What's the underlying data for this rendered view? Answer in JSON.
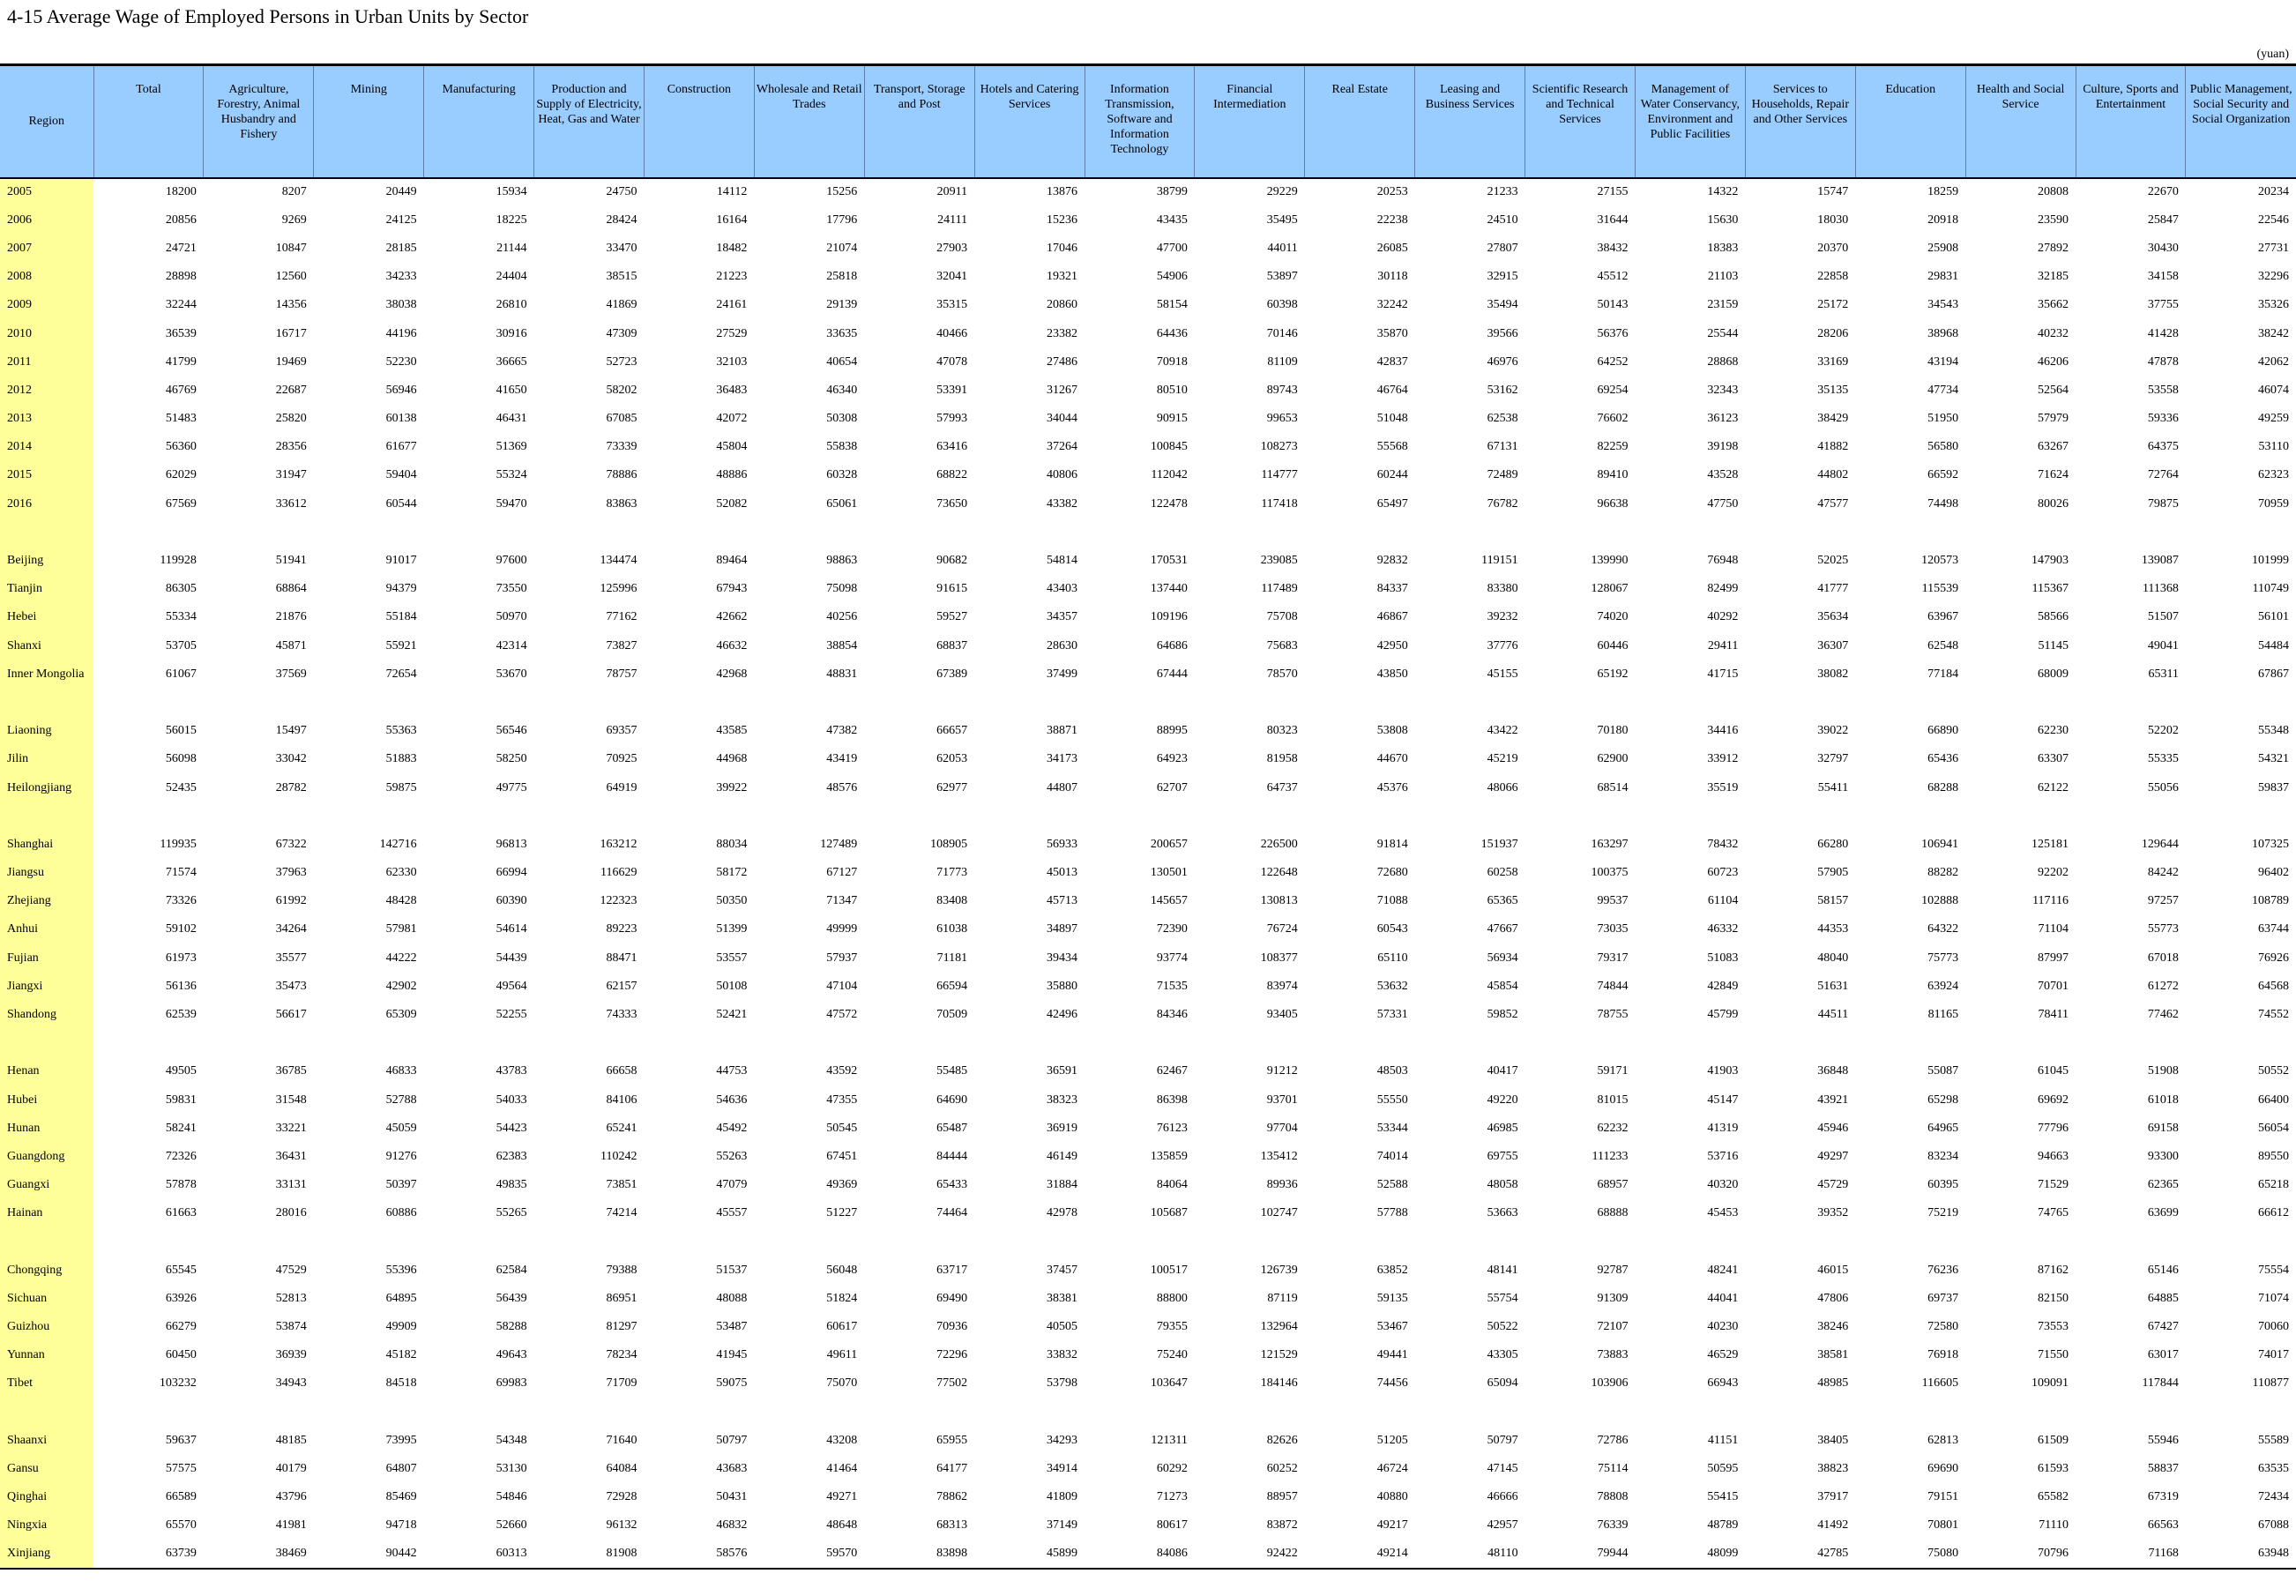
{
  "title": "4-15  Average Wage of Employed Persons in Urban Units by Sector",
  "unit": "(yuan)",
  "columns": [
    "Region",
    "Total",
    "Agriculture, Forestry, Animal Husbandry and Fishery",
    "Mining",
    "Manufacturing",
    "Production and Supply of Electricity, Heat, Gas and Water",
    "Construction",
    "Wholesale and Retail Trades",
    "Transport, Storage and Post",
    "Hotels and Catering Services",
    "Information Transmission, Software and Information Technology",
    "Financial Intermediation",
    "Real Estate",
    "Leasing and Business Services",
    "Scientific Research and Technical Services",
    "Management of Water Conservancy, Environment and Public Facilities",
    "Services to Households, Repair and Other Services",
    "Education",
    "Health and Social Service",
    "Culture, Sports and Entertainment",
    "Public Management, Social Security and Social Organization"
  ],
  "rows": [
    {
      "label": "2005",
      "values": [
        "18200",
        "8207",
        "20449",
        "15934",
        "24750",
        "14112",
        "15256",
        "20911",
        "13876",
        "38799",
        "29229",
        "20253",
        "21233",
        "27155",
        "14322",
        "15747",
        "18259",
        "20808",
        "22670",
        "20234"
      ]
    },
    {
      "label": "2006",
      "values": [
        "20856",
        "9269",
        "24125",
        "18225",
        "28424",
        "16164",
        "17796",
        "24111",
        "15236",
        "43435",
        "35495",
        "22238",
        "24510",
        "31644",
        "15630",
        "18030",
        "20918",
        "23590",
        "25847",
        "22546"
      ]
    },
    {
      "label": "2007",
      "values": [
        "24721",
        "10847",
        "28185",
        "21144",
        "33470",
        "18482",
        "21074",
        "27903",
        "17046",
        "47700",
        "44011",
        "26085",
        "27807",
        "38432",
        "18383",
        "20370",
        "25908",
        "27892",
        "30430",
        "27731"
      ]
    },
    {
      "label": "2008",
      "values": [
        "28898",
        "12560",
        "34233",
        "24404",
        "38515",
        "21223",
        "25818",
        "32041",
        "19321",
        "54906",
        "53897",
        "30118",
        "32915",
        "45512",
        "21103",
        "22858",
        "29831",
        "32185",
        "34158",
        "32296"
      ]
    },
    {
      "label": "2009",
      "values": [
        "32244",
        "14356",
        "38038",
        "26810",
        "41869",
        "24161",
        "29139",
        "35315",
        "20860",
        "58154",
        "60398",
        "32242",
        "35494",
        "50143",
        "23159",
        "25172",
        "34543",
        "35662",
        "37755",
        "35326"
      ]
    },
    {
      "label": "2010",
      "values": [
        "36539",
        "16717",
        "44196",
        "30916",
        "47309",
        "27529",
        "33635",
        "40466",
        "23382",
        "64436",
        "70146",
        "35870",
        "39566",
        "56376",
        "25544",
        "28206",
        "38968",
        "40232",
        "41428",
        "38242"
      ]
    },
    {
      "label": "2011",
      "values": [
        "41799",
        "19469",
        "52230",
        "36665",
        "52723",
        "32103",
        "40654",
        "47078",
        "27486",
        "70918",
        "81109",
        "42837",
        "46976",
        "64252",
        "28868",
        "33169",
        "43194",
        "46206",
        "47878",
        "42062"
      ]
    },
    {
      "label": "2012",
      "values": [
        "46769",
        "22687",
        "56946",
        "41650",
        "58202",
        "36483",
        "46340",
        "53391",
        "31267",
        "80510",
        "89743",
        "46764",
        "53162",
        "69254",
        "32343",
        "35135",
        "47734",
        "52564",
        "53558",
        "46074"
      ]
    },
    {
      "label": "2013",
      "values": [
        "51483",
        "25820",
        "60138",
        "46431",
        "67085",
        "42072",
        "50308",
        "57993",
        "34044",
        "90915",
        "99653",
        "51048",
        "62538",
        "76602",
        "36123",
        "38429",
        "51950",
        "57979",
        "59336",
        "49259"
      ]
    },
    {
      "label": "2014",
      "values": [
        "56360",
        "28356",
        "61677",
        "51369",
        "73339",
        "45804",
        "55838",
        "63416",
        "37264",
        "100845",
        "108273",
        "55568",
        "67131",
        "82259",
        "39198",
        "41882",
        "56580",
        "63267",
        "64375",
        "53110"
      ]
    },
    {
      "label": "2015",
      "values": [
        "62029",
        "31947",
        "59404",
        "55324",
        "78886",
        "48886",
        "60328",
        "68822",
        "40806",
        "112042",
        "114777",
        "60244",
        "72489",
        "89410",
        "43528",
        "44802",
        "66592",
        "71624",
        "72764",
        "62323"
      ]
    },
    {
      "label": "2016",
      "values": [
        "67569",
        "33612",
        "60544",
        "59470",
        "83863",
        "52082",
        "65061",
        "73650",
        "43382",
        "122478",
        "117418",
        "65497",
        "76782",
        "96638",
        "47750",
        "47577",
        "74498",
        "80026",
        "79875",
        "70959"
      ]
    },
    {
      "gap": true
    },
    {
      "label": "Beijing",
      "values": [
        "119928",
        "51941",
        "91017",
        "97600",
        "134474",
        "89464",
        "98863",
        "90682",
        "54814",
        "170531",
        "239085",
        "92832",
        "119151",
        "139990",
        "76948",
        "52025",
        "120573",
        "147903",
        "139087",
        "101999"
      ]
    },
    {
      "label": "Tianjin",
      "values": [
        "86305",
        "68864",
        "94379",
        "73550",
        "125996",
        "67943",
        "75098",
        "91615",
        "43403",
        "137440",
        "117489",
        "84337",
        "83380",
        "128067",
        "82499",
        "41777",
        "115539",
        "115367",
        "111368",
        "110749"
      ]
    },
    {
      "label": "Hebei",
      "values": [
        "55334",
        "21876",
        "55184",
        "50970",
        "77162",
        "42662",
        "40256",
        "59527",
        "34357",
        "109196",
        "75708",
        "46867",
        "39232",
        "74020",
        "40292",
        "35634",
        "63967",
        "58566",
        "51507",
        "56101"
      ]
    },
    {
      "label": "Shanxi",
      "values": [
        "53705",
        "45871",
        "55921",
        "42314",
        "73827",
        "46632",
        "38854",
        "68837",
        "28630",
        "64686",
        "75683",
        "42950",
        "37776",
        "60446",
        "29411",
        "36307",
        "62548",
        "51145",
        "49041",
        "54484"
      ]
    },
    {
      "label": "Inner Mongolia",
      "values": [
        "61067",
        "37569",
        "72654",
        "53670",
        "78757",
        "42968",
        "48831",
        "67389",
        "37499",
        "67444",
        "78570",
        "43850",
        "45155",
        "65192",
        "41715",
        "38082",
        "77184",
        "68009",
        "65311",
        "67867"
      ]
    },
    {
      "gap": true
    },
    {
      "label": "Liaoning",
      "values": [
        "56015",
        "15497",
        "55363",
        "56546",
        "69357",
        "43585",
        "47382",
        "66657",
        "38871",
        "88995",
        "80323",
        "53808",
        "43422",
        "70180",
        "34416",
        "39022",
        "66890",
        "62230",
        "52202",
        "55348"
      ]
    },
    {
      "label": "Jilin",
      "values": [
        "56098",
        "33042",
        "51883",
        "58250",
        "70925",
        "44968",
        "43419",
        "62053",
        "34173",
        "64923",
        "81958",
        "44670",
        "45219",
        "62900",
        "33912",
        "32797",
        "65436",
        "63307",
        "55335",
        "54321"
      ]
    },
    {
      "label": "Heilongjiang",
      "values": [
        "52435",
        "28782",
        "59875",
        "49775",
        "64919",
        "39922",
        "48576",
        "62977",
        "44807",
        "62707",
        "64737",
        "45376",
        "48066",
        "68514",
        "35519",
        "55411",
        "68288",
        "62122",
        "55056",
        "59837"
      ]
    },
    {
      "gap": true
    },
    {
      "label": "Shanghai",
      "values": [
        "119935",
        "67322",
        "142716",
        "96813",
        "163212",
        "88034",
        "127489",
        "108905",
        "56933",
        "200657",
        "226500",
        "91814",
        "151937",
        "163297",
        "78432",
        "66280",
        "106941",
        "125181",
        "129644",
        "107325"
      ]
    },
    {
      "label": "Jiangsu",
      "values": [
        "71574",
        "37963",
        "62330",
        "66994",
        "116629",
        "58172",
        "67127",
        "71773",
        "45013",
        "130501",
        "122648",
        "72680",
        "60258",
        "100375",
        "60723",
        "57905",
        "88282",
        "92202",
        "84242",
        "96402"
      ]
    },
    {
      "label": "Zhejiang",
      "values": [
        "73326",
        "61992",
        "48428",
        "60390",
        "122323",
        "50350",
        "71347",
        "83408",
        "45713",
        "145657",
        "130813",
        "71088",
        "65365",
        "99537",
        "61104",
        "58157",
        "102888",
        "117116",
        "97257",
        "108789"
      ]
    },
    {
      "label": "Anhui",
      "values": [
        "59102",
        "34264",
        "57981",
        "54614",
        "89223",
        "51399",
        "49999",
        "61038",
        "34897",
        "72390",
        "76724",
        "60543",
        "47667",
        "73035",
        "46332",
        "44353",
        "64322",
        "71104",
        "55773",
        "63744"
      ]
    },
    {
      "label": "Fujian",
      "values": [
        "61973",
        "35577",
        "44222",
        "54439",
        "88471",
        "53557",
        "57937",
        "71181",
        "39434",
        "93774",
        "108377",
        "65110",
        "56934",
        "79317",
        "51083",
        "48040",
        "75773",
        "87997",
        "67018",
        "76926"
      ]
    },
    {
      "label": "Jiangxi",
      "values": [
        "56136",
        "35473",
        "42902",
        "49564",
        "62157",
        "50108",
        "47104",
        "66594",
        "35880",
        "71535",
        "83974",
        "53632",
        "45854",
        "74844",
        "42849",
        "51631",
        "63924",
        "70701",
        "61272",
        "64568"
      ]
    },
    {
      "label": "Shandong",
      "values": [
        "62539",
        "56617",
        "65309",
        "52255",
        "74333",
        "52421",
        "47572",
        "70509",
        "42496",
        "84346",
        "93405",
        "57331",
        "59852",
        "78755",
        "45799",
        "44511",
        "81165",
        "78411",
        "77462",
        "74552"
      ]
    },
    {
      "gap": true
    },
    {
      "label": "Henan",
      "values": [
        "49505",
        "36785",
        "46833",
        "43783",
        "66658",
        "44753",
        "43592",
        "55485",
        "36591",
        "62467",
        "91212",
        "48503",
        "40417",
        "59171",
        "41903",
        "36848",
        "55087",
        "61045",
        "51908",
        "50552"
      ]
    },
    {
      "label": "Hubei",
      "values": [
        "59831",
        "31548",
        "52788",
        "54033",
        "84106",
        "54636",
        "47355",
        "64690",
        "38323",
        "86398",
        "93701",
        "55550",
        "49220",
        "81015",
        "45147",
        "43921",
        "65298",
        "69692",
        "61018",
        "66400"
      ]
    },
    {
      "label": "Hunan",
      "values": [
        "58241",
        "33221",
        "45059",
        "54423",
        "65241",
        "45492",
        "50545",
        "65487",
        "36919",
        "76123",
        "97704",
        "53344",
        "46985",
        "62232",
        "41319",
        "45946",
        "64965",
        "77796",
        "69158",
        "56054"
      ]
    },
    {
      "label": "Guangdong",
      "values": [
        "72326",
        "36431",
        "91276",
        "62383",
        "110242",
        "55263",
        "67451",
        "84444",
        "46149",
        "135859",
        "135412",
        "74014",
        "69755",
        "111233",
        "53716",
        "49297",
        "83234",
        "94663",
        "93300",
        "89550"
      ]
    },
    {
      "label": "Guangxi",
      "values": [
        "57878",
        "33131",
        "50397",
        "49835",
        "73851",
        "47079",
        "49369",
        "65433",
        "31884",
        "84064",
        "89936",
        "52588",
        "48058",
        "68957",
        "40320",
        "45729",
        "60395",
        "71529",
        "62365",
        "65218"
      ]
    },
    {
      "label": "Hainan",
      "values": [
        "61663",
        "28016",
        "60886",
        "55265",
        "74214",
        "45557",
        "51227",
        "74464",
        "42978",
        "105687",
        "102747",
        "57788",
        "53663",
        "68888",
        "45453",
        "39352",
        "75219",
        "74765",
        "63699",
        "66612"
      ]
    },
    {
      "gap": true
    },
    {
      "label": "Chongqing",
      "values": [
        "65545",
        "47529",
        "55396",
        "62584",
        "79388",
        "51537",
        "56048",
        "63717",
        "37457",
        "100517",
        "126739",
        "63852",
        "48141",
        "92787",
        "48241",
        "46015",
        "76236",
        "87162",
        "65146",
        "75554"
      ]
    },
    {
      "label": "Sichuan",
      "values": [
        "63926",
        "52813",
        "64895",
        "56439",
        "86951",
        "48088",
        "51824",
        "69490",
        "38381",
        "88800",
        "87119",
        "59135",
        "55754",
        "91309",
        "44041",
        "47806",
        "69737",
        "82150",
        "64885",
        "71074"
      ]
    },
    {
      "label": "Guizhou",
      "values": [
        "66279",
        "53874",
        "49909",
        "58288",
        "81297",
        "53487",
        "60617",
        "70936",
        "40505",
        "79355",
        "132964",
        "53467",
        "50522",
        "72107",
        "40230",
        "38246",
        "72580",
        "73553",
        "67427",
        "70060"
      ]
    },
    {
      "label": "Yunnan",
      "values": [
        "60450",
        "36939",
        "45182",
        "49643",
        "78234",
        "41945",
        "49611",
        "72296",
        "33832",
        "75240",
        "121529",
        "49441",
        "43305",
        "73883",
        "46529",
        "38581",
        "76918",
        "71550",
        "63017",
        "74017"
      ]
    },
    {
      "label": "Tibet",
      "values": [
        "103232",
        "34943",
        "84518",
        "69983",
        "71709",
        "59075",
        "75070",
        "77502",
        "53798",
        "103647",
        "184146",
        "74456",
        "65094",
        "103906",
        "66943",
        "48985",
        "116605",
        "109091",
        "117844",
        "110877"
      ]
    },
    {
      "gap": true
    },
    {
      "label": "Shaanxi",
      "values": [
        "59637",
        "48185",
        "73995",
        "54348",
        "71640",
        "50797",
        "43208",
        "65955",
        "34293",
        "121311",
        "82626",
        "51205",
        "50797",
        "72786",
        "41151",
        "38405",
        "62813",
        "61509",
        "55946",
        "55589"
      ]
    },
    {
      "label": "Gansu",
      "values": [
        "57575",
        "40179",
        "64807",
        "53130",
        "64084",
        "43683",
        "41464",
        "64177",
        "34914",
        "60292",
        "60252",
        "46724",
        "47145",
        "75114",
        "50595",
        "38823",
        "69690",
        "61593",
        "58837",
        "63535"
      ]
    },
    {
      "label": "Qinghai",
      "values": [
        "66589",
        "43796",
        "85469",
        "54846",
        "72928",
        "50431",
        "49271",
        "78862",
        "41809",
        "71273",
        "88957",
        "40880",
        "46666",
        "78808",
        "55415",
        "37917",
        "79151",
        "65582",
        "67319",
        "72434"
      ]
    },
    {
      "label": "Ningxia",
      "values": [
        "65570",
        "41981",
        "94718",
        "52660",
        "96132",
        "46832",
        "48648",
        "68313",
        "37149",
        "80617",
        "83872",
        "49217",
        "42957",
        "76339",
        "48789",
        "41492",
        "70801",
        "71110",
        "66563",
        "67088"
      ]
    },
    {
      "label": "Xinjiang",
      "values": [
        "63739",
        "38469",
        "90442",
        "60313",
        "81908",
        "58576",
        "59570",
        "83898",
        "45899",
        "84086",
        "92422",
        "49214",
        "48110",
        "79944",
        "48099",
        "42785",
        "75080",
        "70796",
        "71168",
        "63948"
      ]
    }
  ]
}
